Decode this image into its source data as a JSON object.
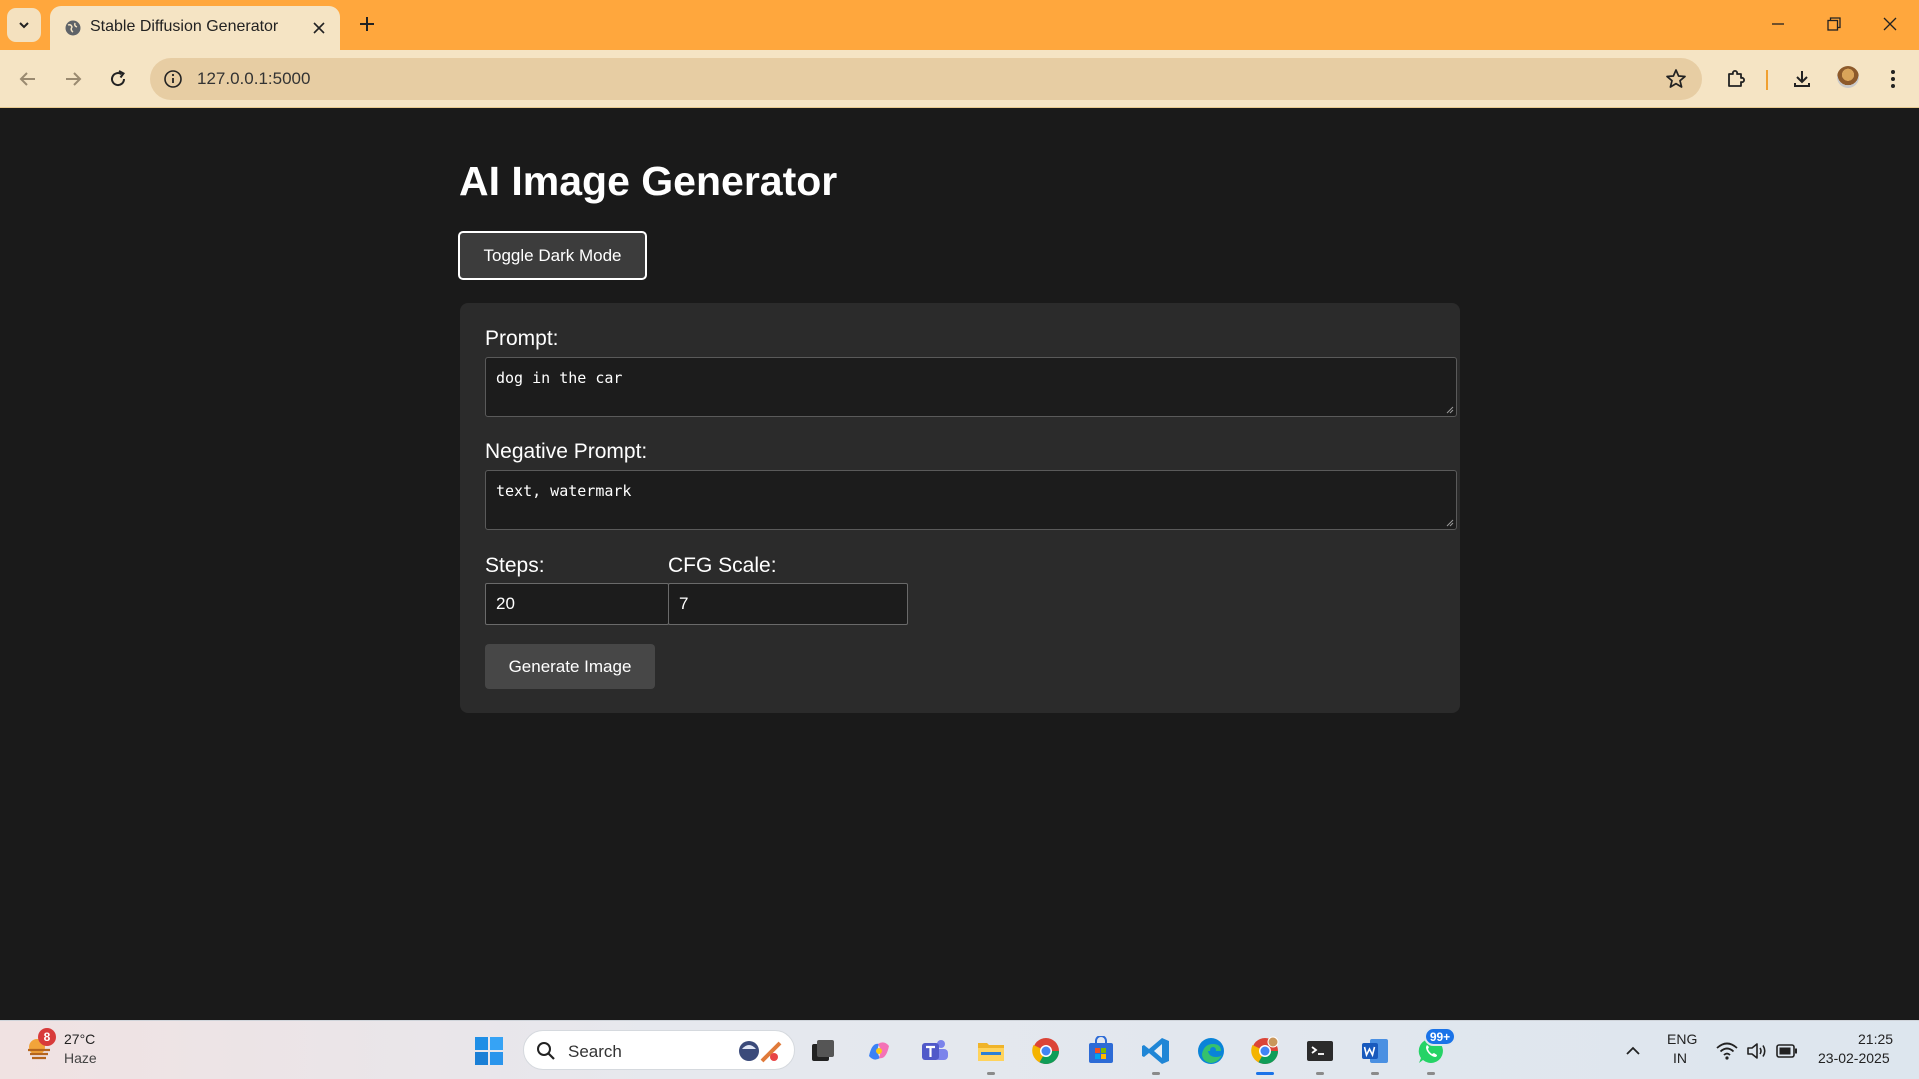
{
  "browser": {
    "tab_title": "Stable Diffusion Generator",
    "url": "127.0.0.1:5000"
  },
  "page": {
    "title": "AI Image Generator",
    "toggle_label": "Toggle Dark Mode",
    "form": {
      "prompt_label": "Prompt:",
      "prompt_value": "dog in the car",
      "negative_label": "Negative Prompt:",
      "negative_value": "text, watermark",
      "steps_label": "Steps:",
      "steps_value": "20",
      "cfg_label": "CFG Scale:",
      "cfg_value": "7",
      "generate_label": "Generate Image"
    }
  },
  "taskbar": {
    "weather_badge": "8",
    "weather_temp": "27°C",
    "weather_desc": "Haze",
    "search_placeholder": "Search",
    "whatsapp_badge": "99+",
    "lang_line1": "ENG",
    "lang_line2": "IN",
    "time": "21:25",
    "date": "23-02-2025"
  },
  "colors": {
    "tabbar": "#ffa73d",
    "toolbar": "#f5e4c4",
    "page_bg": "#1a1a1a",
    "panel_bg": "#2b2b2b",
    "accent": "#1a73e8"
  }
}
